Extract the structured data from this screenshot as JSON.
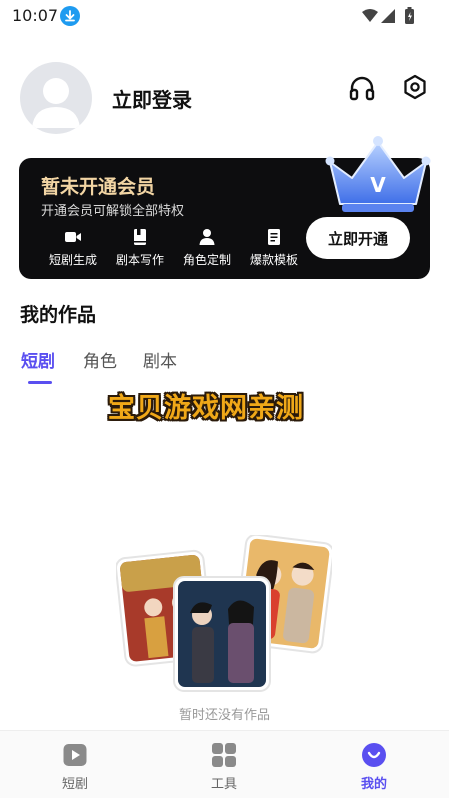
{
  "status_bar": {
    "time": "10:07",
    "icons": [
      "download-icon",
      "wifi-icon",
      "signal-icon",
      "battery-icon"
    ]
  },
  "profile": {
    "login_label": "立即登录",
    "icons": [
      "headphones-icon",
      "settings-icon"
    ]
  },
  "vip": {
    "title": "暂未开通会员",
    "subtitle": "开通会员可解锁全部特权",
    "perks": [
      {
        "label": "短剧生成",
        "icon": "video-camera-icon"
      },
      {
        "label": "剧本写作",
        "icon": "book-icon"
      },
      {
        "label": "角色定制",
        "icon": "person-icon"
      },
      {
        "label": "爆款模板",
        "icon": "document-icon"
      }
    ],
    "button_label": "立即开通",
    "crown_letter": "V",
    "accent_color": "#f2d5a4"
  },
  "works": {
    "title": "我的作品",
    "tabs": [
      {
        "label": "短剧",
        "active": true
      },
      {
        "label": "角色",
        "active": false
      },
      {
        "label": "剧本",
        "active": false
      }
    ],
    "watermark": "宝贝游戏网亲测",
    "empty_text": "暂时还没有作品"
  },
  "bottom_nav": [
    {
      "label": "短剧",
      "icon": "play-icon",
      "active": false
    },
    {
      "label": "工具",
      "icon": "grid-icon",
      "active": false
    },
    {
      "label": "我的",
      "icon": "smile-icon",
      "active": true
    }
  ],
  "colors": {
    "accent": "#5a4ff0",
    "vip_background": "#0d0d0f"
  }
}
